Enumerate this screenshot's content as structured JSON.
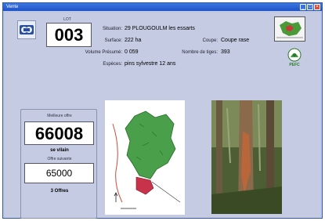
{
  "window": {
    "title": "Vente"
  },
  "lot": {
    "label": "LOT",
    "value": "003"
  },
  "details": {
    "situation_label": "Situation:",
    "situation_value": "29 PLOUGOULM les essarts",
    "surface_label": "Surface:",
    "surface_value": "222 ha",
    "coupe_label": "Coupe:",
    "coupe_value": "Coupe rase",
    "volume_label": "Volume Présumé:",
    "volume_value": "0 059",
    "tiges_label": "Nombre de tiges:",
    "tiges_value": "393",
    "especes_label": "Espèces:",
    "especes_value": "pins sylvestre 12 ans"
  },
  "certification": {
    "label": "PEFC"
  },
  "offers": {
    "best_label": "Meilleure offre",
    "best_value": "66008",
    "bidder": "se vilain",
    "next_label": "Offre suivante",
    "next_value": "65000",
    "count_text": "3 Offres"
  },
  "colors": {
    "window_bg": "#c4cbe2",
    "titlebar": "#2a60d0",
    "forest_green": "#3a8a3a",
    "parcel_red": "#c8324a"
  }
}
